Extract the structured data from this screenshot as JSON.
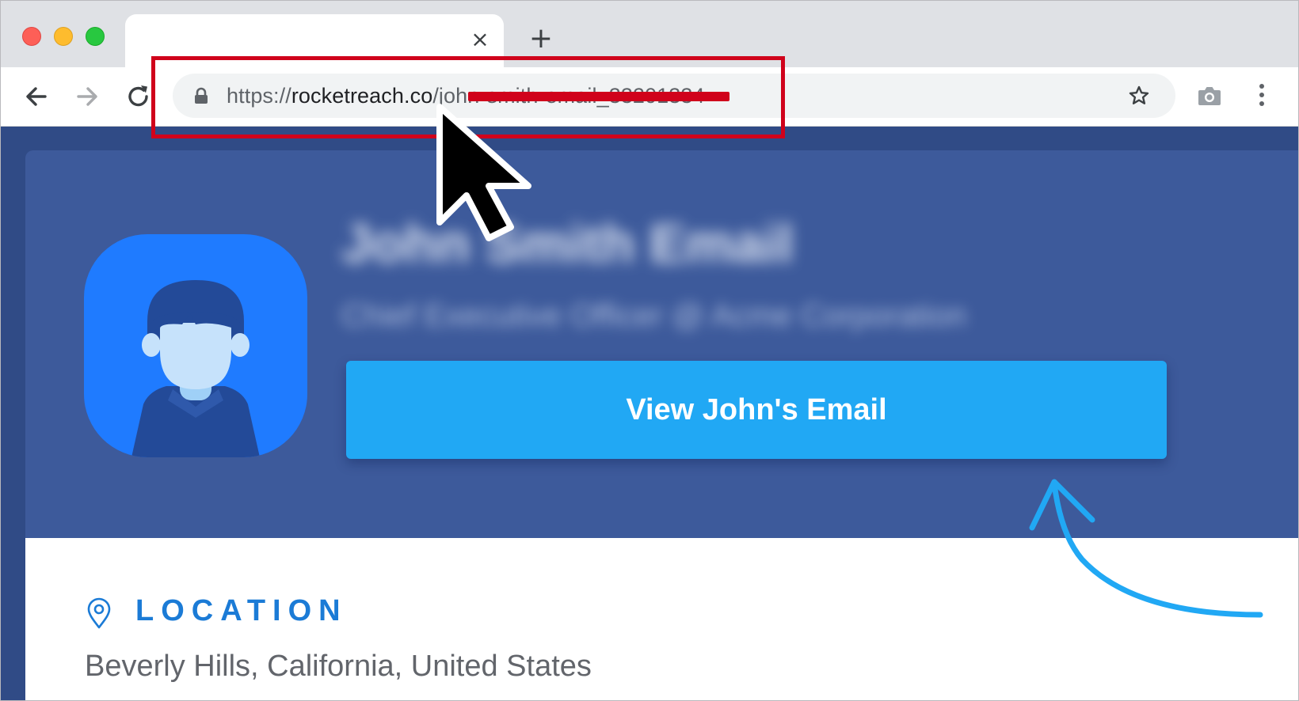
{
  "browser": {
    "tab": {
      "title": "",
      "close_glyph": "×"
    },
    "new_tab_glyph": "+",
    "address_bar": {
      "url_scheme": "https://",
      "url_host": "rocketreach.co",
      "url_path": "/john-smith-email_33201334"
    },
    "icons": [
      "back-arrow-icon",
      "forward-arrow-icon",
      "reload-icon",
      "lock-icon",
      "star-icon",
      "camera-icon",
      "more-menu-icon"
    ]
  },
  "profile": {
    "name": "John Smith Email",
    "title": "Chief Executive Officer @ Acme Corporation",
    "cta_label": "View John's Email"
  },
  "location": {
    "label": "LOCATION",
    "value": "Beverly Hills, California, United States"
  },
  "colors": {
    "hero_bg": "#3d5a9b",
    "cta_bg": "#21a8f4",
    "highlight": "#d0021b",
    "location_label": "#1b7bd6",
    "annotation_arrow": "#21a8f4"
  }
}
